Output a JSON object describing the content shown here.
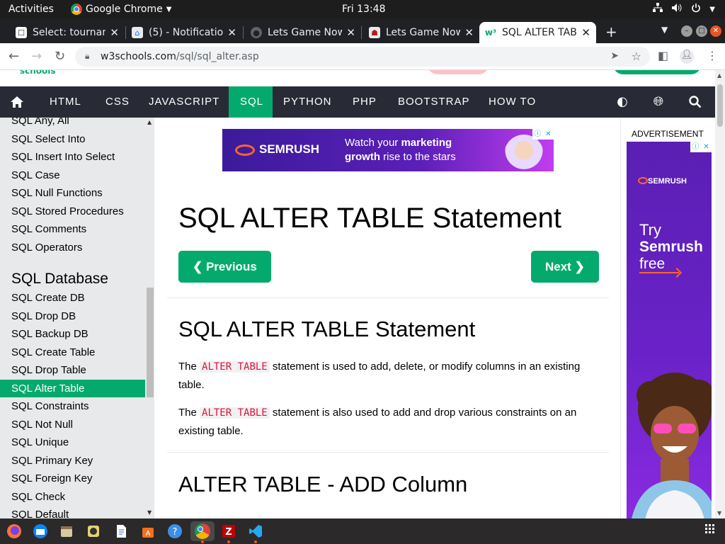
{
  "topbar": {
    "activities": "Activities",
    "app_name": "Google Chrome",
    "clock": "Fri 13:48"
  },
  "tabs": [
    {
      "title": "Select: tournam",
      "icon": "select-favicon"
    },
    {
      "title": "(5) - Notificatio",
      "icon": "notifications-favicon"
    },
    {
      "title": "Lets Game Now",
      "icon": "globe-favicon"
    },
    {
      "title": "Lets Game Now",
      "icon": "game-favicon"
    },
    {
      "title": "SQL ALTER TABL",
      "icon": "w3schools-favicon",
      "active": true
    }
  ],
  "browser": {
    "url_host": "w3schools.com",
    "url_path": "/sql/sql_alter.asp"
  },
  "site": {
    "logo_tail": "schools",
    "nav": [
      "HTML",
      "CSS",
      "JAVASCRIPT",
      "SQL",
      "PYTHON",
      "PHP",
      "BOOTSTRAP",
      "HOW TO"
    ],
    "active_nav": "SQL"
  },
  "sidebar": {
    "items_top": [
      "SQL Any, All",
      "SQL Select Into",
      "SQL Insert Into Select",
      "SQL Case",
      "SQL Null Functions",
      "SQL Stored Procedures",
      "SQL Comments",
      "SQL Operators"
    ],
    "heading": "SQL Database",
    "items_db": [
      "SQL Create DB",
      "SQL Drop DB",
      "SQL Backup DB",
      "SQL Create Table",
      "SQL Drop Table",
      "SQL Alter Table",
      "SQL Constraints",
      "SQL Not Null",
      "SQL Unique",
      "SQL Primary Key",
      "SQL Foreign Key",
      "SQL Check",
      "SQL Default"
    ],
    "active_item": "SQL Alter Table"
  },
  "banner_ad": {
    "brand": "SEMRUSH",
    "line1_pre": "Watch your ",
    "line1_bold": "marketing",
    "line2_bold": "growth",
    "line2_post": " rise to the stars"
  },
  "main": {
    "page_title": "SQL ALTER TABLE Statement",
    "prev_label": "❮ Previous",
    "next_label": "Next ❯",
    "section1_title": "SQL ALTER TABLE Statement",
    "p1_pre": "The ",
    "p1_code": "ALTER TABLE",
    "p1_post": " statement is used to add, delete, or modify columns in an existing table.",
    "p2_pre": "The ",
    "p2_code": "ALTER TABLE",
    "p2_post": " statement is also used to add and drop various constraints on an existing table.",
    "section2_title": "ALTER TABLE - ADD Column"
  },
  "right_ad": {
    "label": "ADVERTISEMENT",
    "brand": "SEMRUSH",
    "line1": "Try",
    "line2": "Semrush",
    "line3": "free"
  },
  "colors": {
    "accent": "#04aa6d",
    "nav_bg": "#282a35",
    "sidebar_bg": "#e7e9eb",
    "code_text": "#dc143c",
    "ad_purple": "#5a1fb3"
  }
}
